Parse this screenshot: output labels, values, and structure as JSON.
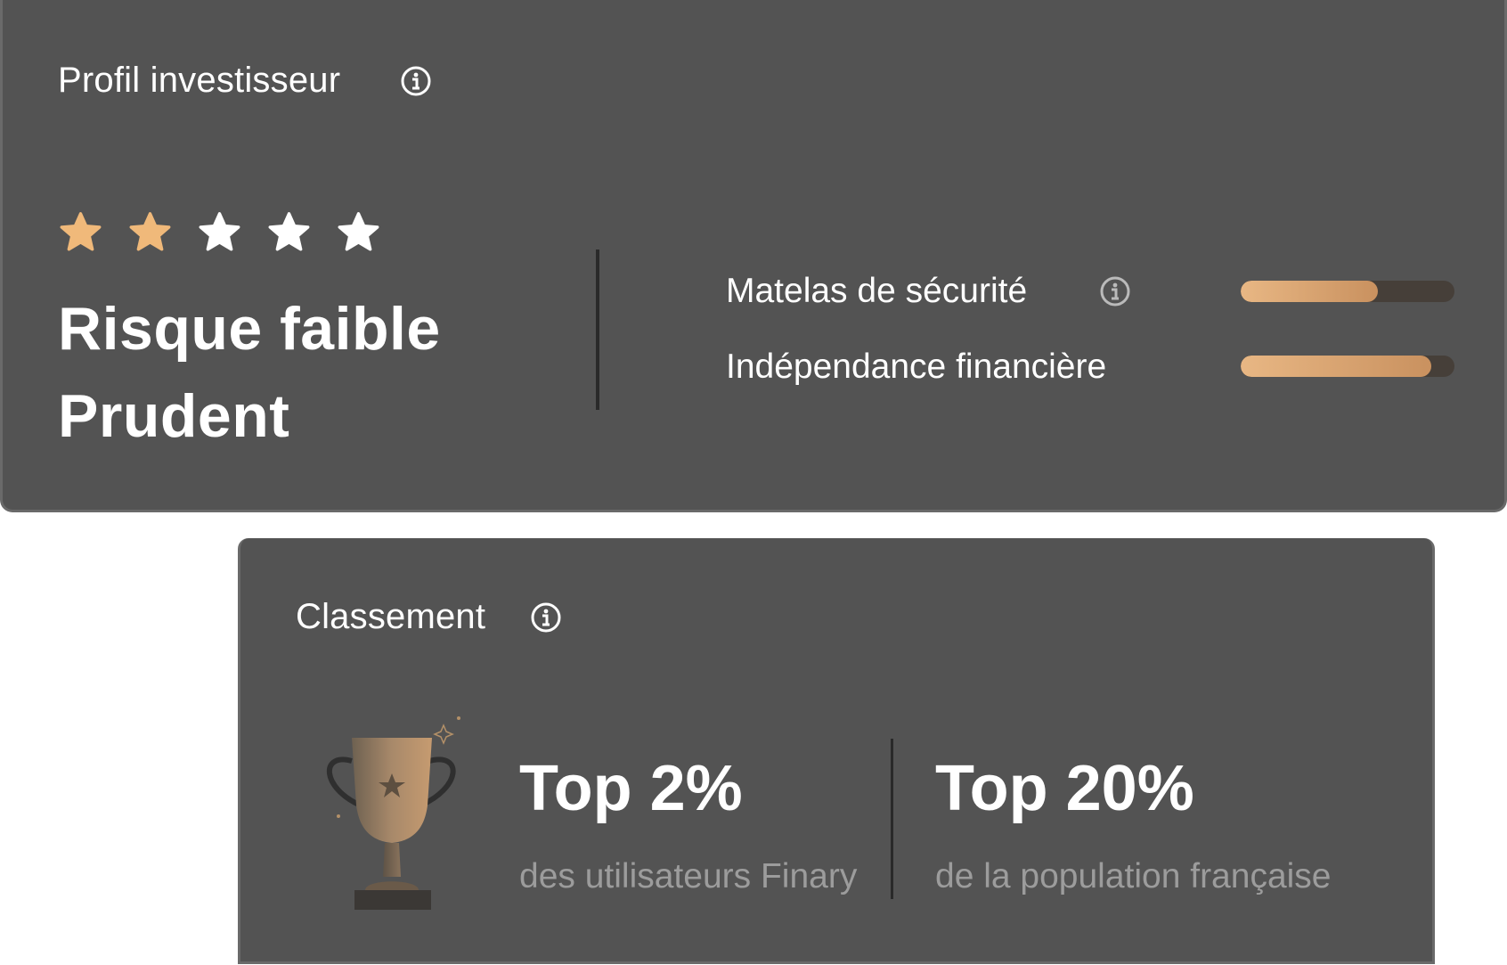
{
  "profile": {
    "title": "Profil investisseur",
    "rating": {
      "filled": 2,
      "total": 5
    },
    "risk_label": "Risque faible",
    "profile_label": "Prudent",
    "metrics": [
      {
        "label": "Matelas de sécurité",
        "has_info": true,
        "level": 0.64
      },
      {
        "label": "Indépendance financière",
        "has_info": false,
        "level": 0.89
      }
    ]
  },
  "ranking": {
    "title": "Classement",
    "stats": [
      {
        "value": "Top 2%",
        "caption": "des utilisateurs Finary"
      },
      {
        "value": "Top 20%",
        "caption": "de la population française"
      }
    ]
  },
  "icons": {
    "info": "info-icon",
    "star": "star-icon",
    "trophy": "trophy-icon"
  },
  "colors": {
    "card_bg": "#535353",
    "star_filled": "#f0b97a",
    "star_empty": "#ffffff",
    "bar_fill": "#e0a875",
    "bar_track": "#463f39",
    "caption": "#9c9c9c"
  }
}
